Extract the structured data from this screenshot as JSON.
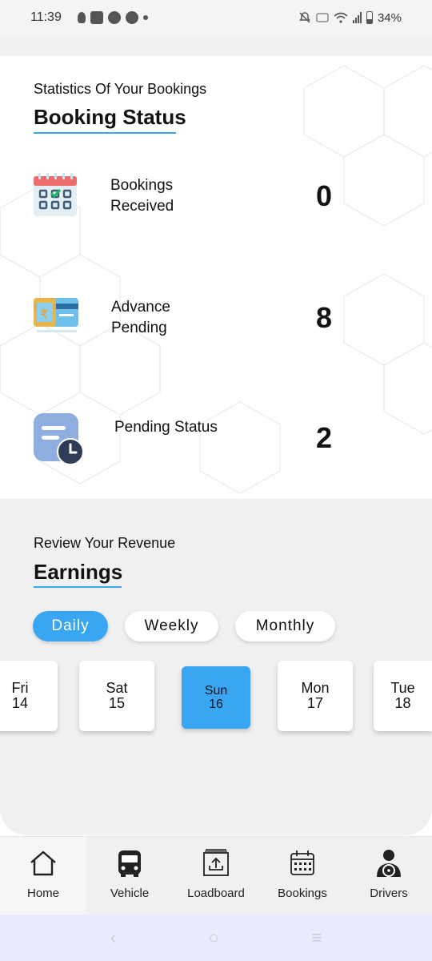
{
  "status_bar": {
    "time": "11:39",
    "battery": "34%"
  },
  "booking": {
    "subtitle": "Statistics Of Your Bookings",
    "title": "Booking Status",
    "stats": [
      {
        "label": "Bookings Received",
        "value": "0",
        "icon": "calendar-icon"
      },
      {
        "label": "Advance Pending",
        "value": "8",
        "icon": "card-icon"
      },
      {
        "label": "Pending Status",
        "value": "2",
        "icon": "pending-clock-icon"
      }
    ]
  },
  "earnings": {
    "subtitle": "Review Your Revenue",
    "title": "Earnings",
    "tabs": [
      {
        "label": "Daily",
        "active": true
      },
      {
        "label": "Weekly",
        "active": false
      },
      {
        "label": "Monthly",
        "active": false
      }
    ],
    "days": [
      {
        "day": "Fri",
        "date": "14"
      },
      {
        "day": "Sat",
        "date": "15"
      },
      {
        "day": "Sun",
        "date": "16",
        "active": true
      },
      {
        "day": "Mon",
        "date": "17"
      },
      {
        "day": "Tue",
        "date": "18"
      }
    ]
  },
  "bottom_nav": [
    {
      "label": "Home",
      "icon": "home-icon",
      "active": true
    },
    {
      "label": "Vehicle",
      "icon": "bus-icon"
    },
    {
      "label": "Loadboard",
      "icon": "upload-box-icon"
    },
    {
      "label": "Bookings",
      "icon": "calendar-grid-icon"
    },
    {
      "label": "Drivers",
      "icon": "driver-icon"
    }
  ],
  "colors": {
    "accent": "#39a6f3",
    "section_bg": "#f0f0f0"
  }
}
